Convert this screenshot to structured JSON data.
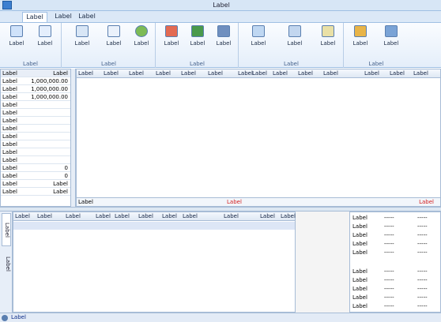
{
  "window": {
    "title": "Label"
  },
  "menu_tabs": [
    "Label",
    "Label",
    "Label"
  ],
  "ribbon_groups": [
    {
      "caption": "Label",
      "buttons": [
        {
          "label": "Label",
          "icon": "line-chart-icon"
        },
        {
          "label": "Label",
          "icon": "chart-window-icon"
        }
      ]
    },
    {
      "caption": "Label",
      "buttons": [
        {
          "label": "Label",
          "icon": "user-info-icon"
        },
        {
          "label": "Label",
          "icon": "bar-chart-icon"
        },
        {
          "label": "Label",
          "icon": "globe-icon"
        }
      ]
    },
    {
      "caption": "Label",
      "buttons": [
        {
          "label": "Label",
          "icon": "buy-icon"
        },
        {
          "label": "Label",
          "icon": "sell-icon"
        },
        {
          "label": "Label",
          "icon": "cancel-order-icon"
        }
      ]
    },
    {
      "caption": "Label",
      "buttons": [
        {
          "label": "Label",
          "icon": "delegation-icon"
        },
        {
          "label": "Label",
          "icon": "transactions-icon"
        },
        {
          "label": "Label",
          "icon": "history-icon"
        }
      ]
    },
    {
      "caption": "Label",
      "buttons": [
        {
          "label": "Label",
          "icon": "flowing-coins-icon"
        },
        {
          "label": "Label",
          "icon": "feather-icon"
        }
      ]
    }
  ],
  "account": {
    "header": {
      "key": "Label",
      "value": "Label"
    },
    "rows": [
      {
        "key": "Label",
        "value": "1,000,000.00"
      },
      {
        "key": "Label",
        "value": "1,000,000.00"
      },
      {
        "key": "Label",
        "value": "1,000,000.00"
      },
      {
        "key": "Label",
        "value": ""
      },
      {
        "key": "Label",
        "value": ""
      },
      {
        "key": "Label",
        "value": ""
      },
      {
        "key": "Label",
        "value": ""
      },
      {
        "key": "Label",
        "value": ""
      },
      {
        "key": "Label",
        "value": ""
      },
      {
        "key": "Label",
        "value": ""
      },
      {
        "key": "Label",
        "value": ""
      },
      {
        "key": "Label",
        "value": "0"
      },
      {
        "key": "Label",
        "value": "0"
      },
      {
        "key": "Label",
        "value": "Label"
      },
      {
        "key": "Label",
        "value": "Label"
      }
    ]
  },
  "holdings": {
    "columns": [
      "Label",
      "Label",
      "Label",
      "Label",
      "Label",
      "Label",
      "Label",
      "Label",
      "Label",
      "Label",
      "Label",
      "Label",
      "Label",
      "Label"
    ],
    "footer_count": "Label",
    "footer_hint": "Label",
    "footer_help": "Label"
  },
  "bottom_tabs": [
    "Label",
    "Label"
  ],
  "quote": {
    "columns": [
      "Label",
      "Label",
      "Label",
      "Label",
      "Label",
      "Label",
      "Label",
      "Label",
      "Label",
      "Label",
      "Label"
    ]
  },
  "depth": {
    "asks": [
      {
        "label": "Label",
        "price": "-----",
        "vol": "-----"
      },
      {
        "label": "Label",
        "price": "-----",
        "vol": "-----"
      },
      {
        "label": "Label",
        "price": "-----",
        "vol": "-----"
      },
      {
        "label": "Label",
        "price": "-----",
        "vol": "-----"
      },
      {
        "label": "Label",
        "price": "-----",
        "vol": "-----"
      }
    ],
    "bids": [
      {
        "label": "Label",
        "price": "-----",
        "vol": "-----"
      },
      {
        "label": "Label",
        "price": "-----",
        "vol": "-----"
      },
      {
        "label": "Label",
        "price": "-----",
        "vol": "-----"
      },
      {
        "label": "Label",
        "price": "-----",
        "vol": "-----"
      },
      {
        "label": "Label",
        "price": "-----",
        "vol": "-----"
      }
    ]
  },
  "status": {
    "text": "Label"
  },
  "colors": {
    "accent": "#3c7fd0",
    "hint_red": "#d21e1e",
    "status_blue": "#0b2a86"
  }
}
